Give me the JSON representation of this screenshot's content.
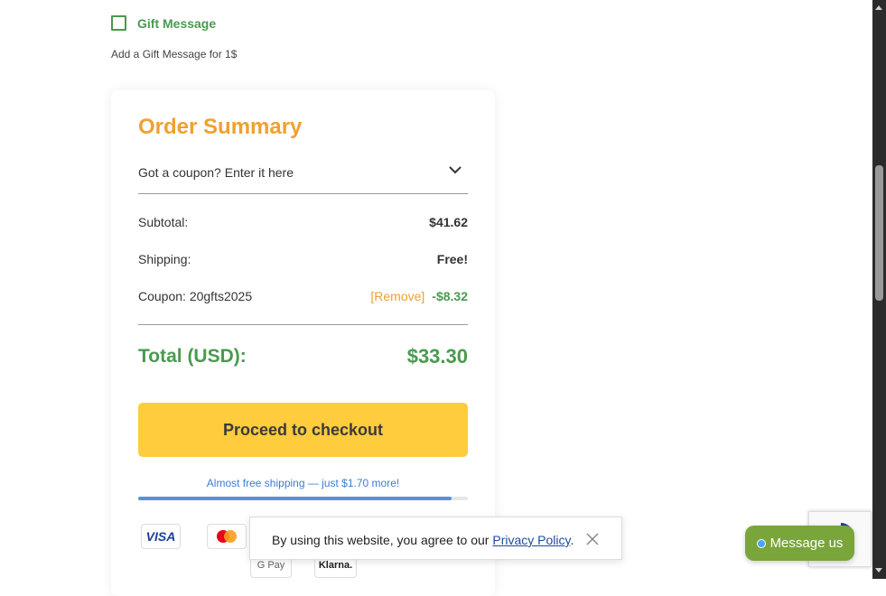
{
  "gift": {
    "label": "Gift Message",
    "note": "Add a Gift Message for 1$",
    "checked": false
  },
  "summary": {
    "title": "Order Summary",
    "coupon_prompt": "Got a coupon? Enter it here",
    "subtotal_label": "Subtotal:",
    "subtotal_value": "$41.62",
    "shipping_label": "Shipping:",
    "shipping_value": "Free!",
    "coupon_label": "Coupon: 20gfts2025",
    "coupon_remove": "[Remove]",
    "coupon_discount": "-$8.32",
    "total_label": "Total (USD):",
    "total_value": "$33.30",
    "checkout_label": "Proceed to checkout",
    "shipping_progress_text": "Almost free shipping — just $1.70 more!",
    "shipping_progress_percent": 95
  },
  "payments": {
    "visa": "VISA",
    "gpay": "G Pay",
    "klarna": "Klarna."
  },
  "cookie": {
    "text_before": "By using this website, you agree to our ",
    "link": "Privacy Policy",
    "text_after": "."
  },
  "chat": {
    "label": "Message us"
  },
  "colors": {
    "accent_orange": "#f0a030",
    "accent_green": "#4a9a4f",
    "checkout_yellow": "#ffcc3d",
    "progress_blue": "#5a8fdc"
  }
}
